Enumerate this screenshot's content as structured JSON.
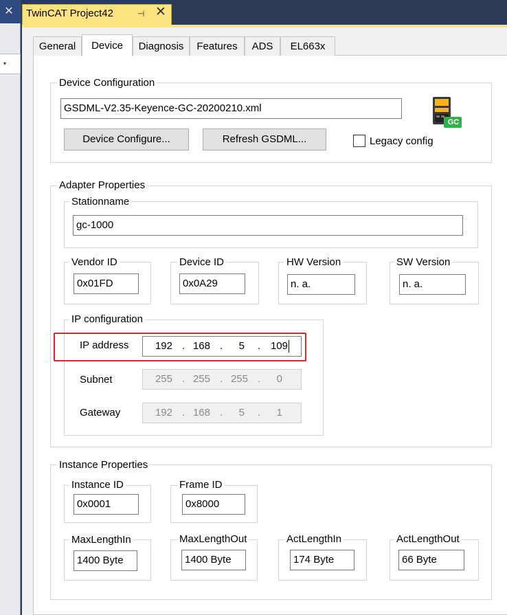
{
  "left_panel": {
    "close_glyph": "✕",
    "combo_arrow": "▾"
  },
  "document_tab": {
    "title": "TwinCAT Project42",
    "pin_glyph": "⊣",
    "close_glyph": "✕"
  },
  "tabs": [
    "General",
    "Device",
    "Diagnosis",
    "Features",
    "ADS",
    "EL663x"
  ],
  "active_tab": "Device",
  "device_configuration": {
    "label": "Device Configuration",
    "gsdml_file": "GSDML-V2.35-Keyence-GC-20200210.xml",
    "configure_button": "Device Configure...",
    "refresh_button": "Refresh GSDML...",
    "legacy_config_label": "Legacy config",
    "legacy_config_checked": false,
    "device_icon_badge": "GC"
  },
  "adapter_properties": {
    "label": "Adapter Properties",
    "stationname_label": "Stationname",
    "stationname": "gc-1000",
    "vendor_id_label": "Vendor ID",
    "vendor_id": "0x01FD",
    "device_id_label": "Device ID",
    "device_id": "0x0A29",
    "hw_version_label": "HW Version",
    "hw_version": "n. a.",
    "sw_version_label": "SW Version",
    "sw_version": "n. a.",
    "ip_configuration": {
      "label": "IP configuration",
      "ip_address_label": "IP address",
      "ip_address": [
        "192",
        "168",
        "5",
        "109"
      ],
      "subnet_label": "Subnet",
      "subnet": [
        "255",
        "255",
        "255",
        "0"
      ],
      "gateway_label": "Gateway",
      "gateway": [
        "192",
        "168",
        "5",
        "1"
      ],
      "separator": ".",
      "highlight_color": "#d9262b"
    }
  },
  "instance_properties": {
    "label": "Instance Properties",
    "instance_id_label": "Instance ID",
    "instance_id": "0x0001",
    "frame_id_label": "Frame ID",
    "frame_id": "0x8000",
    "max_length_in_label": "MaxLengthIn",
    "max_length_in": "1400 Byte",
    "max_length_out_label": "MaxLengthOut",
    "max_length_out": "1400 Byte",
    "act_length_in_label": "ActLengthIn",
    "act_length_in": "174 Byte",
    "act_length_out_label": "ActLengthOut",
    "act_length_out": "66 Byte"
  },
  "colors": {
    "doc_tab": "#fce37f",
    "panel_bg": "#f0f0f0",
    "icon_green": "#2db34a",
    "icon_yellow": "#f2b51c"
  }
}
